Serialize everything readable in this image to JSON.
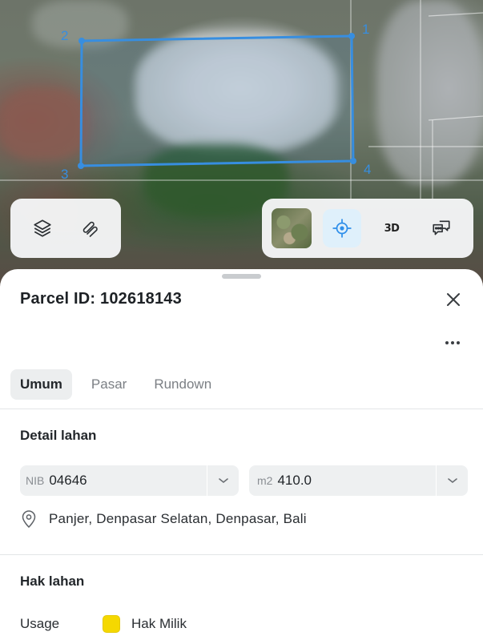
{
  "map": {
    "parcel_vertices": [
      "1",
      "2",
      "3",
      "4"
    ]
  },
  "toolbar_left": {
    "icons": [
      "layers-icon",
      "measure-icon"
    ]
  },
  "toolbar_right": {
    "icons": [
      "satellite-thumbnail",
      "locate-icon",
      "3d-toggle",
      "comment-icon"
    ],
    "label_3d": "3D"
  },
  "sheet": {
    "title": "Parcel ID: 102618143",
    "tabs": [
      {
        "label": "Umum",
        "active": true
      },
      {
        "label": "Pasar",
        "active": false
      },
      {
        "label": "Rundown",
        "active": false
      }
    ],
    "detail": {
      "section_title": "Detail lahan",
      "nib": {
        "prefix": "NIB",
        "value": "04646"
      },
      "area": {
        "prefix": "m2",
        "value": "410.0"
      },
      "address": "Panjer, Denpasar Selatan, Denpasar, Bali"
    },
    "rights": {
      "section_title": "Hak lahan",
      "usage_label": "Usage",
      "usage_value": "Hak Milik",
      "usage_color": "#F5D800"
    }
  },
  "colors": {
    "parcel_outline": "#2F8FEA",
    "accent_active": "#DFF0FB"
  }
}
